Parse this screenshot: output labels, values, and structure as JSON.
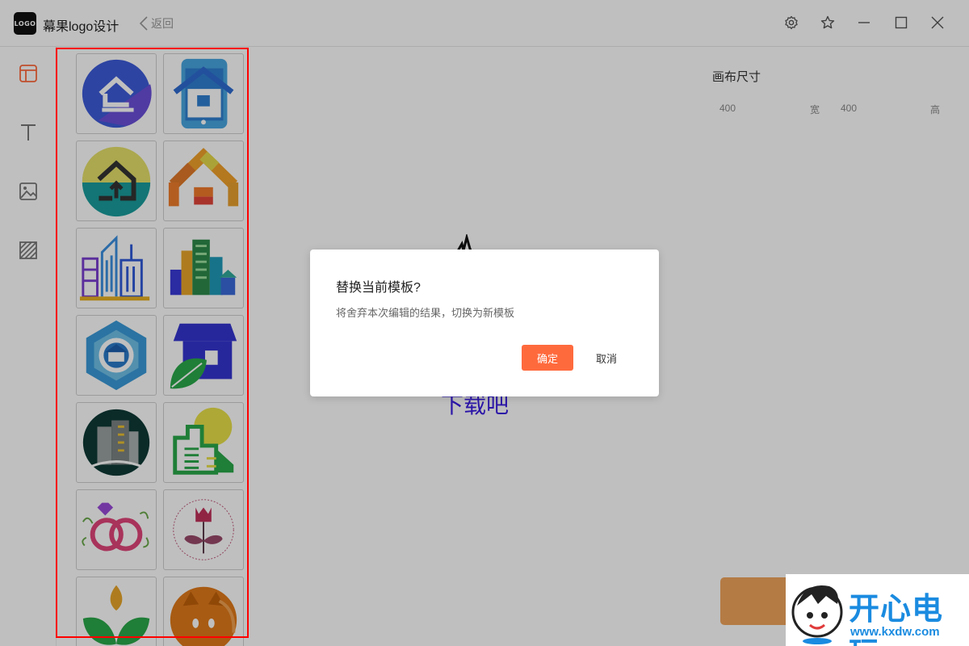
{
  "app": {
    "logo_text": "LOGO",
    "title": "幕果logo设计",
    "back_label": "返回"
  },
  "window_controls": [
    "gear-icon",
    "star-icon",
    "minimize-icon",
    "maximize-icon",
    "close-icon"
  ],
  "tools": [
    {
      "name": "template",
      "icon": "layout-icon",
      "active": true
    },
    {
      "name": "text",
      "icon": "text-icon",
      "active": false
    },
    {
      "name": "image",
      "icon": "image-icon",
      "active": false
    },
    {
      "name": "background",
      "icon": "pattern-icon",
      "active": false
    }
  ],
  "templates": [
    "house-logo-blue",
    "house-phone-logo",
    "house-yellow-teal-logo",
    "house-orange-logo",
    "city-outline-logo",
    "city-color-logo",
    "hexagon-house-logo",
    "shop-leaf-logo",
    "dark-building-logo",
    "green-building-sun-logo",
    "rings-logo",
    "rose-logo",
    "sprout-logo",
    "orange-cat-logo"
  ],
  "canvas": {
    "size_label": "画布尺寸",
    "width_value": "400",
    "width_unit": "宽",
    "height_value": "400",
    "height_unit": "高",
    "preview_text": "下载吧"
  },
  "dialog": {
    "title": "替换当前模板?",
    "message": "将舍弃本次编辑的结果，切换为新模板",
    "confirm_label": "确定",
    "cancel_label": "取消"
  },
  "watermark": {
    "text": "开心电玩",
    "url": "www.kxdw.com"
  },
  "colors": {
    "accent": "#ff6a3d",
    "active_tool": "#ff6a3d",
    "highlight": "#ff0000"
  }
}
